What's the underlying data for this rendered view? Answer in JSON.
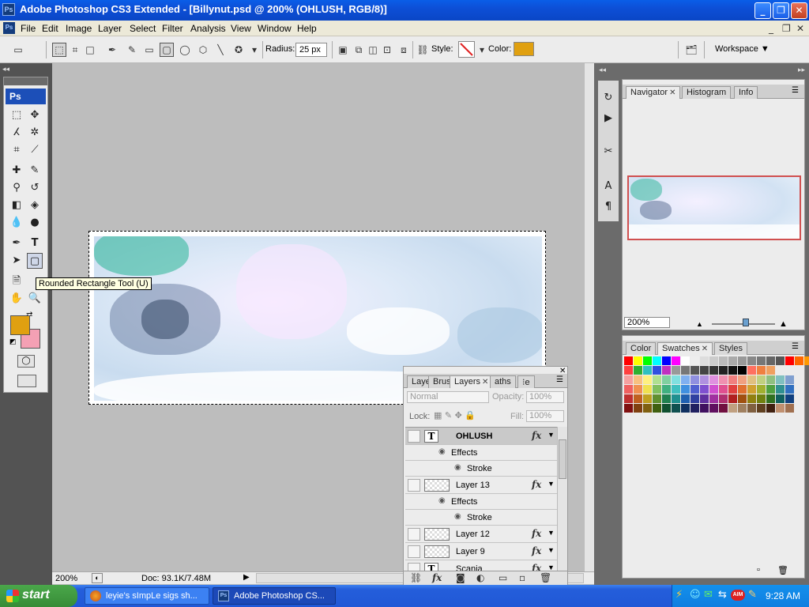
{
  "window": {
    "title": "Adobe Photoshop CS3 Extended - [Billynut.psd @ 200% (OHLUSH, RGB/8)]",
    "ps_badge": "Ps",
    "min": "_",
    "max": "❐",
    "close": "✕"
  },
  "menu": {
    "items": [
      "File",
      "Edit",
      "Image",
      "Layer",
      "Select",
      "Filter",
      "Analysis",
      "View",
      "Window",
      "Help"
    ],
    "doc_min": "_",
    "doc_restore": "❐",
    "doc_close": "✕"
  },
  "options": {
    "radius_label": "Radius:",
    "radius_value": "25 px",
    "style_label": "Style:",
    "color_label": "Color:",
    "color_hex": "#e0a010",
    "workspace_label": "Workspace ▼"
  },
  "toolbox": {
    "logo": "Ps",
    "foreground": "#e0a010",
    "background": "#f4a0b4",
    "tooltip": "Rounded Rectangle Tool (U)"
  },
  "status": {
    "zoom": "200%",
    "doc_info": "Doc: 93.1K/7.48M"
  },
  "navigator": {
    "tabs": [
      "Navigator",
      "Histogram",
      "Info"
    ],
    "zoom": "200%"
  },
  "swatches_panel": {
    "tabs": [
      "Color",
      "Swatches",
      "Styles"
    ]
  },
  "layers_panel": {
    "tabs": [
      "Laye",
      "Brus",
      "Layers",
      "aths",
      "e"
    ],
    "blend_mode": "Normal",
    "opacity_label": "Opacity:",
    "opacity": "100%",
    "lock_label": "Lock:",
    "fill_label": "Fill:",
    "fill": "100%",
    "rows": [
      {
        "kind": "layer",
        "name": "OHLUSH",
        "thumb": "T",
        "fx": "fx",
        "selected": true
      },
      {
        "kind": "effects",
        "name": "Effects"
      },
      {
        "kind": "effect",
        "name": "Stroke"
      },
      {
        "kind": "layer",
        "name": "Layer 13",
        "thumb": "img",
        "fx": "fx"
      },
      {
        "kind": "effects",
        "name": "Effects"
      },
      {
        "kind": "effect",
        "name": "Stroke"
      },
      {
        "kind": "layer",
        "name": "Layer 12",
        "thumb": "img",
        "fx": "fx"
      },
      {
        "kind": "layer",
        "name": "Layer 9",
        "thumb": "img",
        "fx": "fx"
      },
      {
        "kind": "layer",
        "name": "Scania",
        "thumb": "T",
        "fx": "fx"
      }
    ]
  },
  "taskbar": {
    "start": "start",
    "tasks": [
      "leyie's sImpLe sigs sh...",
      "Adobe Photoshop CS..."
    ],
    "clock": "9:28 AM"
  }
}
